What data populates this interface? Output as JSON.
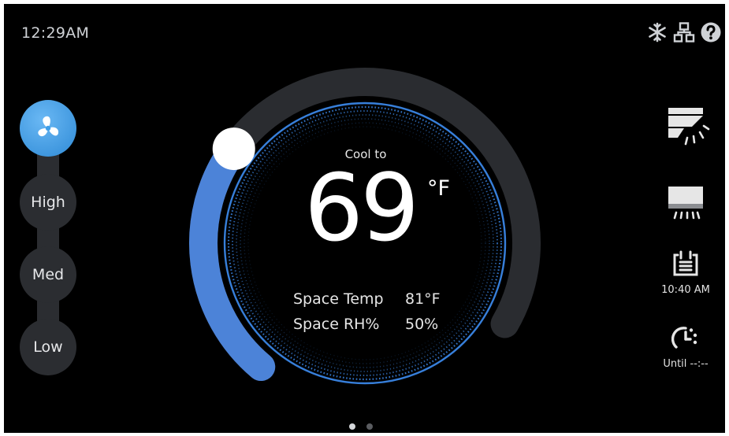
{
  "status_bar": {
    "time": "12:29AM",
    "icons": [
      "snowflake-icon",
      "network-icon",
      "help-icon"
    ]
  },
  "fan": {
    "mode_icon": "fan-icon",
    "speeds": [
      {
        "label": "High"
      },
      {
        "label": "Med"
      },
      {
        "label": "Low"
      }
    ],
    "selected": "auto"
  },
  "thermostat": {
    "mode_label": "Cool to",
    "setpoint": "69",
    "unit": "°F",
    "space_temp_label": "Space Temp",
    "space_temp_value": "81°F",
    "space_rh_label": "Space RH%",
    "space_rh_value": "50%",
    "setpoint_fraction": 0.33
  },
  "side_controls": {
    "louver_swing_icon": "louver-swing-icon",
    "louver_fixed_icon": "louver-fixed-icon",
    "schedule_icon": "schedule-icon",
    "schedule_time": "10:40 AM",
    "timer_icon": "timer-icon",
    "timer_label": "Until --:--"
  },
  "pagination": {
    "pages": 2,
    "current": 1
  },
  "colors": {
    "background": "#000000",
    "accent": "#4c83d8",
    "active_fan": "#3f9ee8",
    "track": "#2b2d31",
    "dotted_ring": "#3a86e6"
  }
}
